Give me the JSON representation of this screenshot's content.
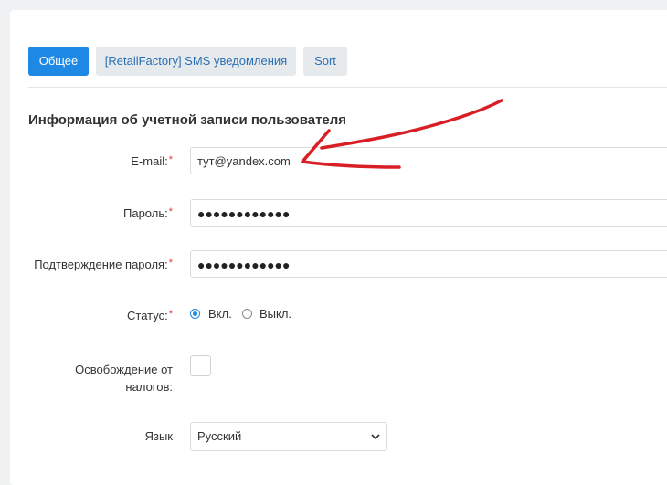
{
  "tabs": [
    {
      "label": "Общее",
      "active": true
    },
    {
      "label": "[RetailFactory] SMS уведомления",
      "active": false
    },
    {
      "label": "Sort",
      "active": false
    }
  ],
  "section_title": "Информация об учетной записи пользователя",
  "fields": {
    "email": {
      "label": "E-mail:",
      "required": "*",
      "value": "тут@yandex.com"
    },
    "password": {
      "label": "Пароль:",
      "required": "*",
      "value": "●●●●●●●●●●●●"
    },
    "confirm_password": {
      "label": "Подтверждение пароля:",
      "required": "*",
      "value": "●●●●●●●●●●●●"
    },
    "status": {
      "label": "Статус:",
      "required": "*",
      "options": [
        "Вкл.",
        "Выкл."
      ],
      "selected": "Вкл."
    },
    "tax_exempt": {
      "label_line1": "Освобождение от",
      "label_line2": "налогов:",
      "checked": false
    },
    "language": {
      "label": "Язык",
      "value": "Русский"
    }
  },
  "colors": {
    "accent": "#1e88e5",
    "required": "#e53935",
    "annotation_arrow": "#d81f26"
  }
}
